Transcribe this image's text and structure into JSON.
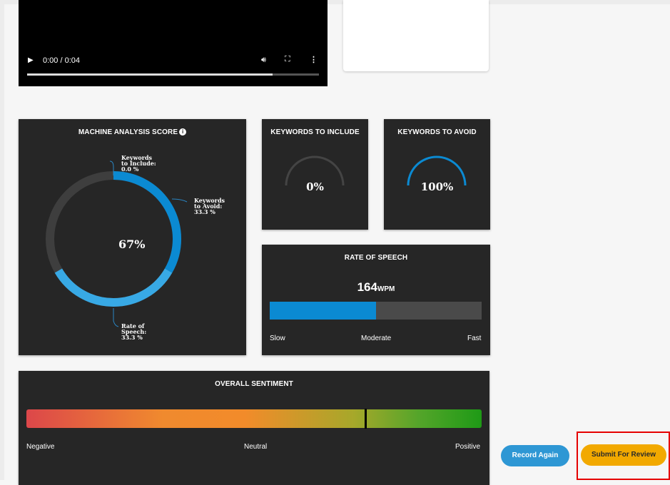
{
  "video": {
    "play_icon": "play-icon",
    "time": "0:00 / 0:04",
    "volume_icon": "volume-icon",
    "fullscreen_icon": "fullscreen-icon",
    "more_icon": "more-vert-icon",
    "progress": 0.84
  },
  "score": {
    "title": "MACHINE ANALYSIS SCORE",
    "info_icon": "info-icon",
    "value": "67%",
    "labels": {
      "include": [
        "Keywords",
        "to Include:",
        "0.0 %"
      ],
      "avoid": [
        "Keywords",
        "to Avoid:",
        "33.3 %"
      ],
      "speech": [
        "Rate of",
        "Speech:",
        "33.3 %"
      ]
    },
    "segments": {
      "include": 0.0,
      "avoid": 33.3,
      "speech": 33.3
    }
  },
  "include": {
    "title": "KEYWORDS TO INCLUDE",
    "value": "0%",
    "level": 0
  },
  "avoid": {
    "title": "KEYWORDS TO AVOID",
    "value": "100%",
    "level": 1
  },
  "rate": {
    "title": "RATE OF SPEECH",
    "value": "164",
    "unit": "WPM",
    "fill": 0.5,
    "scale": [
      "Slow",
      "Moderate",
      "Fast"
    ]
  },
  "sentiment": {
    "title": "OVERALL SENTIMENT",
    "position": 0.745,
    "scale": [
      "Negative",
      "Neutral",
      "Positive"
    ]
  },
  "buttons": {
    "record": "Record Again",
    "submit": "Submit For Review"
  },
  "colors": {
    "accent_blue": "#0b8ad2",
    "submit": "#f2a900",
    "record": "#2e97d4",
    "highlight": "#e50000"
  }
}
